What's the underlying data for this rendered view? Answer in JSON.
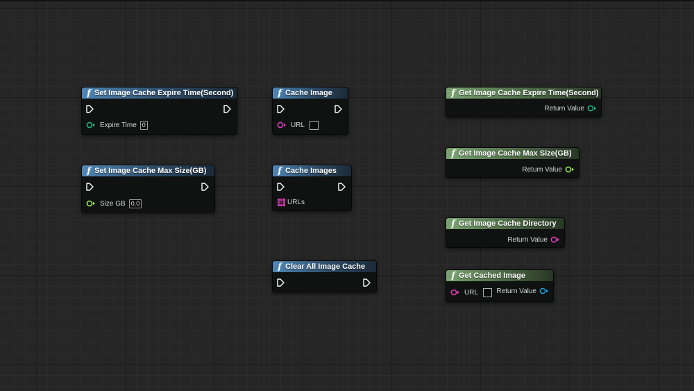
{
  "nodes": {
    "set_expire": {
      "title": "Set Image Cache Expire Time(Second)",
      "param_label": "Expire Time",
      "param_value": "0"
    },
    "set_max_size": {
      "title": "Set Image Cache Max Size(GB)",
      "param_label": "Size GB",
      "param_value": "0.0"
    },
    "cache_image": {
      "title": "Cache Image",
      "param_label": "URL"
    },
    "cache_images": {
      "title": "Cache Images",
      "param_label": "URLs"
    },
    "clear_all": {
      "title": "Clear All Image Cache"
    },
    "get_expire": {
      "title": "Get Image Cache Expire Time(Second)",
      "return_label": "Return Value"
    },
    "get_max_size": {
      "title": "Get Image Cache Max Size(GB)",
      "return_label": "Return Value"
    },
    "get_directory": {
      "title": "Get Image Cache Directory",
      "return_label": "Return Value"
    },
    "get_cached_image": {
      "title": "Get Cached Image",
      "param_label": "URL",
      "return_label": "Return Value"
    }
  },
  "function_glyph": "f",
  "icons": [
    "function-icon",
    "exec-pin-icon",
    "data-pin-icon",
    "array-pin-icon"
  ],
  "colors": {
    "exec_pin": "#ffffff",
    "int_pin": "#1fb582",
    "float_pin": "#99e65c",
    "string_pin": "#e03db8",
    "object_pin": "#1a9ed8",
    "callable_header": "#4f86b6",
    "pure_header": "#7aa371"
  }
}
